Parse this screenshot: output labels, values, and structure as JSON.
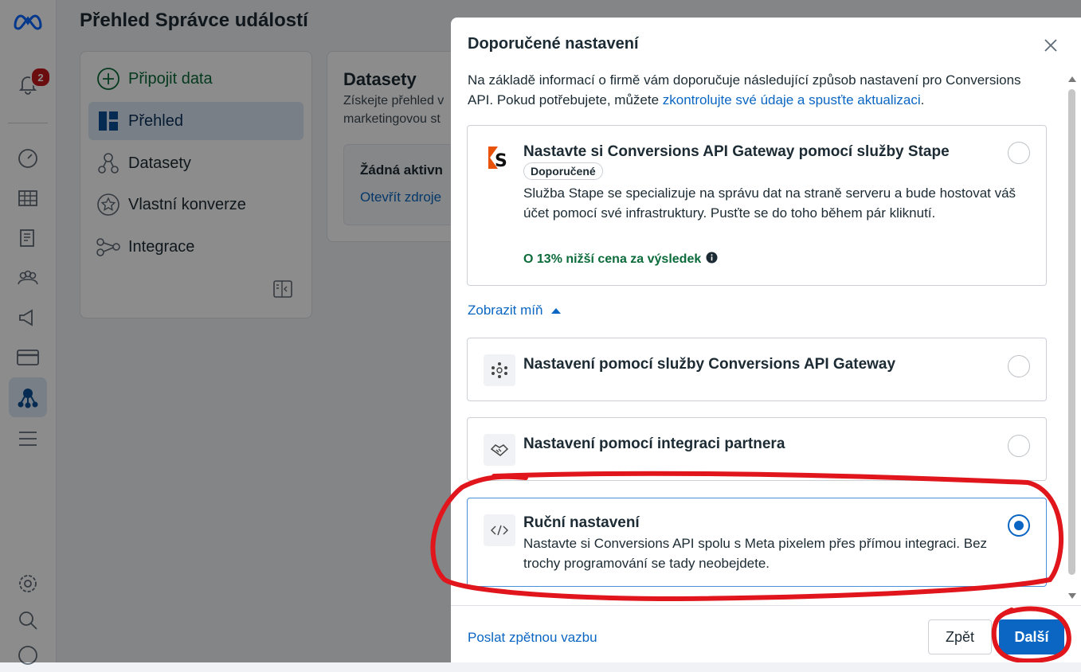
{
  "app": {
    "page_title": "Přehled Správce událostí",
    "notification_count": "2"
  },
  "rail": {
    "icons": [
      "meta-logo-icon",
      "bell-icon",
      "dashboard-icon",
      "table-icon",
      "pages-icon",
      "people-icon",
      "megaphone-icon",
      "card-icon",
      "events-manager-icon",
      "menu-icon",
      "settings-icon",
      "search-icon",
      "help-icon"
    ]
  },
  "leftnav": {
    "items": [
      {
        "label": "Připojit data",
        "icon": "plus-circle-icon"
      },
      {
        "label": "Přehled",
        "icon": "overview-icon"
      },
      {
        "label": "Datasety",
        "icon": "datasets-icon"
      },
      {
        "label": "Vlastní konverze",
        "icon": "star-circle-icon"
      },
      {
        "label": "Integrace",
        "icon": "integration-icon"
      }
    ]
  },
  "dataset_card": {
    "title": "Datasety",
    "desc_line1": "Získejte přehled v",
    "desc_line2": "marketingovou st",
    "inner_heading": "Žádná aktivn",
    "inner_link": "Otevřít zdroje"
  },
  "modal": {
    "title": "Doporučené nastavení",
    "intro_text": "Na základě informací o firmě vám doporučuje následující způsob nastavení pro Conversions API. Pokud potřebujete, můžete ",
    "intro_link": "zkontrolujte své údaje a spusťte aktualizaci",
    "intro_end": ".",
    "options": [
      {
        "title": "Nastavte si Conversions API Gateway pomocí služby Stape",
        "badge": "Doporučené",
        "description": "Služba Stape se specializuje na správu dat na straně serveru a bude hostovat váš účet pomocí své infrastruktury. Pusťte se do toho během pár kliknutí.",
        "savings": "O 13% nižší cena za výsledek",
        "selected": false
      },
      {
        "title": "Nastavení pomocí služby Conversions API Gateway",
        "selected": false
      },
      {
        "title": "Nastavení pomocí integraci partnera",
        "selected": false
      },
      {
        "title": "Ruční nastavení",
        "description": "Nastavte si Conversions API spolu s Meta pixelem přes přímou integraci. Bez trochy programování se tady neobejdete.",
        "selected": true
      }
    ],
    "toggle_label": "Zobrazit míň",
    "feedback_link": "Poslat zpětnou vazbu",
    "back_button": "Zpět",
    "next_button": "Další"
  },
  "colors": {
    "accent": "#0a66c2",
    "success": "#0b6b3a",
    "annotation": "#e0161c"
  }
}
